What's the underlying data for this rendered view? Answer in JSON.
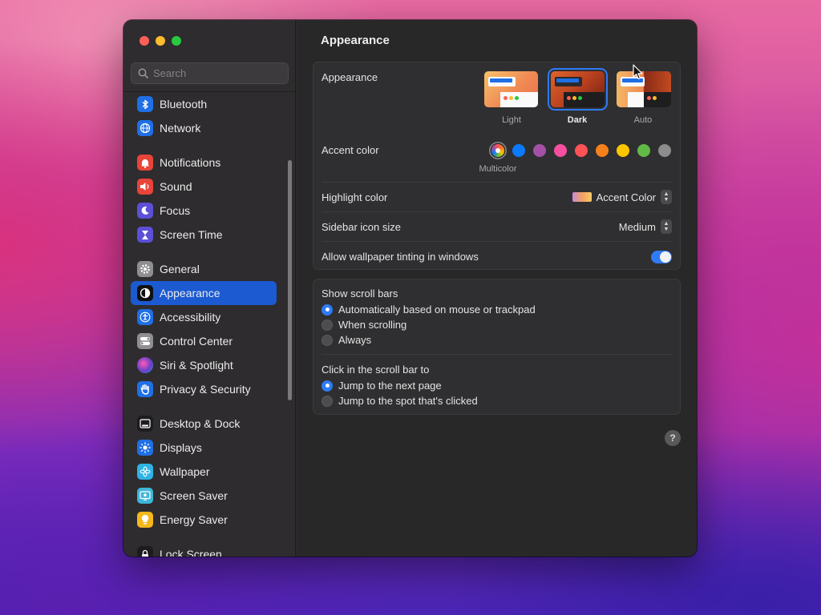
{
  "window": {
    "title": "Appearance",
    "controls": [
      "close",
      "minimize",
      "zoom"
    ]
  },
  "sidebar": {
    "search_placeholder": "Search",
    "items": [
      {
        "label": "Bluetooth",
        "icon": "bluetooth-icon",
        "color": "#1f6fe5"
      },
      {
        "label": "Network",
        "icon": "globe-icon",
        "color": "#1f6fe5"
      },
      {
        "label": "Notifications",
        "icon": "bell-icon",
        "color": "#e8443a"
      },
      {
        "label": "Sound",
        "icon": "speaker-icon",
        "color": "#e8443a"
      },
      {
        "label": "Focus",
        "icon": "moon-icon",
        "color": "#5d4fd6"
      },
      {
        "label": "Screen Time",
        "icon": "hourglass-icon",
        "color": "#5d4fd6"
      },
      {
        "label": "General",
        "icon": "gear-icon",
        "color": "#8e8e93"
      },
      {
        "label": "Appearance",
        "icon": "appearance-icon",
        "color": "#111111",
        "selected": true
      },
      {
        "label": "Accessibility",
        "icon": "accessibility-icon",
        "color": "#1f6fe5"
      },
      {
        "label": "Control Center",
        "icon": "switches-icon",
        "color": "#8e8e93"
      },
      {
        "label": "Siri & Spotlight",
        "icon": "siri-icon",
        "color": "#6a3fc8"
      },
      {
        "label": "Privacy & Security",
        "icon": "hand-icon",
        "color": "#1f6fe5"
      },
      {
        "label": "Desktop & Dock",
        "icon": "dock-icon",
        "color": "#1c1c1e"
      },
      {
        "label": "Displays",
        "icon": "sun-icon",
        "color": "#1f6fe5"
      },
      {
        "label": "Wallpaper",
        "icon": "flower-icon",
        "color": "#2fb3e6"
      },
      {
        "label": "Screen Saver",
        "icon": "screensaver-icon",
        "color": "#3fb6d9"
      },
      {
        "label": "Energy Saver",
        "icon": "lightbulb-icon",
        "color": "#f5b81c"
      },
      {
        "label": "Lock Screen",
        "icon": "lock-icon",
        "color": "#1c1c1e"
      }
    ]
  },
  "appearance_card": {
    "appearance_label": "Appearance",
    "modes": [
      {
        "label": "Light",
        "selected": false
      },
      {
        "label": "Dark",
        "selected": true
      },
      {
        "label": "Auto",
        "selected": false
      }
    ],
    "accent_label": "Accent color",
    "accent_colors": [
      "multicolor",
      "#0a7aff",
      "#a550a7",
      "#f74f9e",
      "#ff5257",
      "#f7821b",
      "#ffc600",
      "#62ba46",
      "#8c8c8c"
    ],
    "accent_selected_name": "Multicolor",
    "highlight_label": "Highlight color",
    "highlight_value": "Accent Color",
    "sidebar_icon_label": "Sidebar icon size",
    "sidebar_icon_value": "Medium",
    "tinting_label": "Allow wallpaper tinting in windows",
    "tinting_on": true
  },
  "scroll_card": {
    "show_label": "Show scroll bars",
    "show_options": [
      {
        "label": "Automatically based on mouse or trackpad",
        "selected": true
      },
      {
        "label": "When scrolling",
        "selected": false
      },
      {
        "label": "Always",
        "selected": false
      }
    ],
    "click_label": "Click in the scroll bar to",
    "click_options": [
      {
        "label": "Jump to the next page",
        "selected": true
      },
      {
        "label": "Jump to the spot that's clicked",
        "selected": false
      }
    ]
  },
  "help_label": "?"
}
